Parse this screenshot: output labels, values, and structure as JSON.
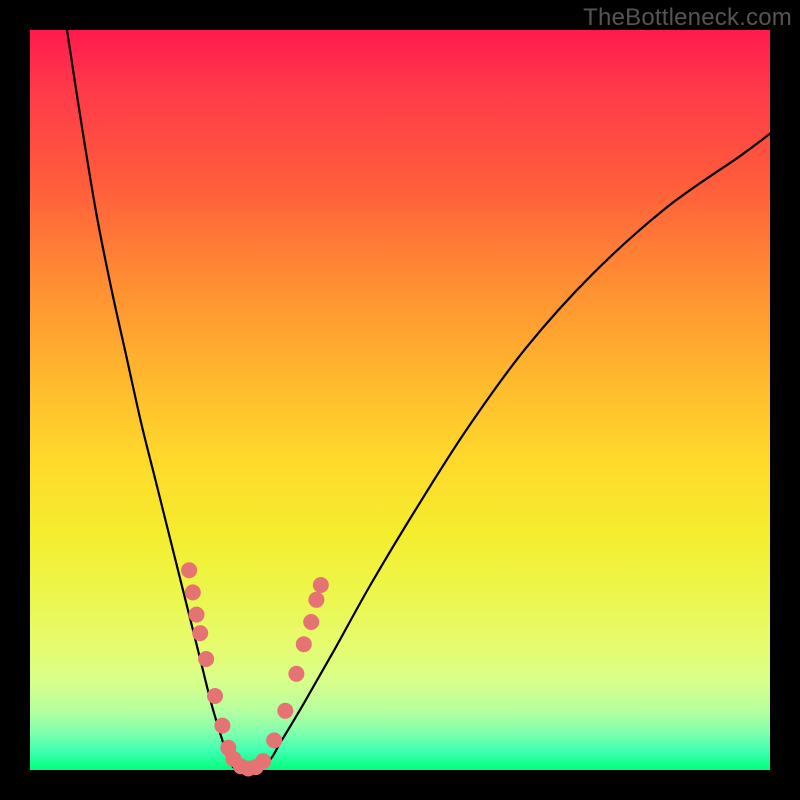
{
  "watermark": "TheBottleneck.com",
  "colors": {
    "curve": "#000000",
    "marker_fill": "#e57373",
    "marker_stroke": "#c25a5a",
    "background_black": "#000000"
  },
  "chart_data": {
    "type": "line",
    "title": "",
    "xlabel": "",
    "ylabel": "",
    "xlim": [
      0,
      100
    ],
    "ylim": [
      0,
      100
    ],
    "grid": false,
    "legend": null,
    "series": [
      {
        "name": "curve",
        "x": [
          5,
          7,
          9,
          11,
          13,
          15,
          17,
          19,
          21,
          23,
          24.5,
          26,
          27,
          28.5,
          32,
          34,
          37,
          41,
          46,
          52,
          59,
          67,
          76,
          86,
          96,
          100
        ],
        "y": [
          100,
          87,
          75,
          65,
          56,
          47,
          39,
          31,
          23,
          15,
          9,
          4,
          1,
          0,
          1,
          4,
          9,
          16,
          25,
          35,
          46,
          57,
          67,
          76,
          83,
          86
        ]
      }
    ],
    "markers": [
      {
        "x": 21.5,
        "y": 27
      },
      {
        "x": 22.0,
        "y": 24
      },
      {
        "x": 22.5,
        "y": 21
      },
      {
        "x": 23.0,
        "y": 18.5
      },
      {
        "x": 23.8,
        "y": 15
      },
      {
        "x": 25.0,
        "y": 10
      },
      {
        "x": 26.0,
        "y": 6
      },
      {
        "x": 26.8,
        "y": 3
      },
      {
        "x": 27.5,
        "y": 1.5
      },
      {
        "x": 28.5,
        "y": 0.5
      },
      {
        "x": 29.5,
        "y": 0.2
      },
      {
        "x": 30.5,
        "y": 0.4
      },
      {
        "x": 31.5,
        "y": 1.2
      },
      {
        "x": 33.0,
        "y": 4
      },
      {
        "x": 34.5,
        "y": 8
      },
      {
        "x": 36.0,
        "y": 13
      },
      {
        "x": 37.0,
        "y": 17
      },
      {
        "x": 38.0,
        "y": 20
      },
      {
        "x": 38.7,
        "y": 23
      },
      {
        "x": 39.3,
        "y": 25
      }
    ]
  }
}
